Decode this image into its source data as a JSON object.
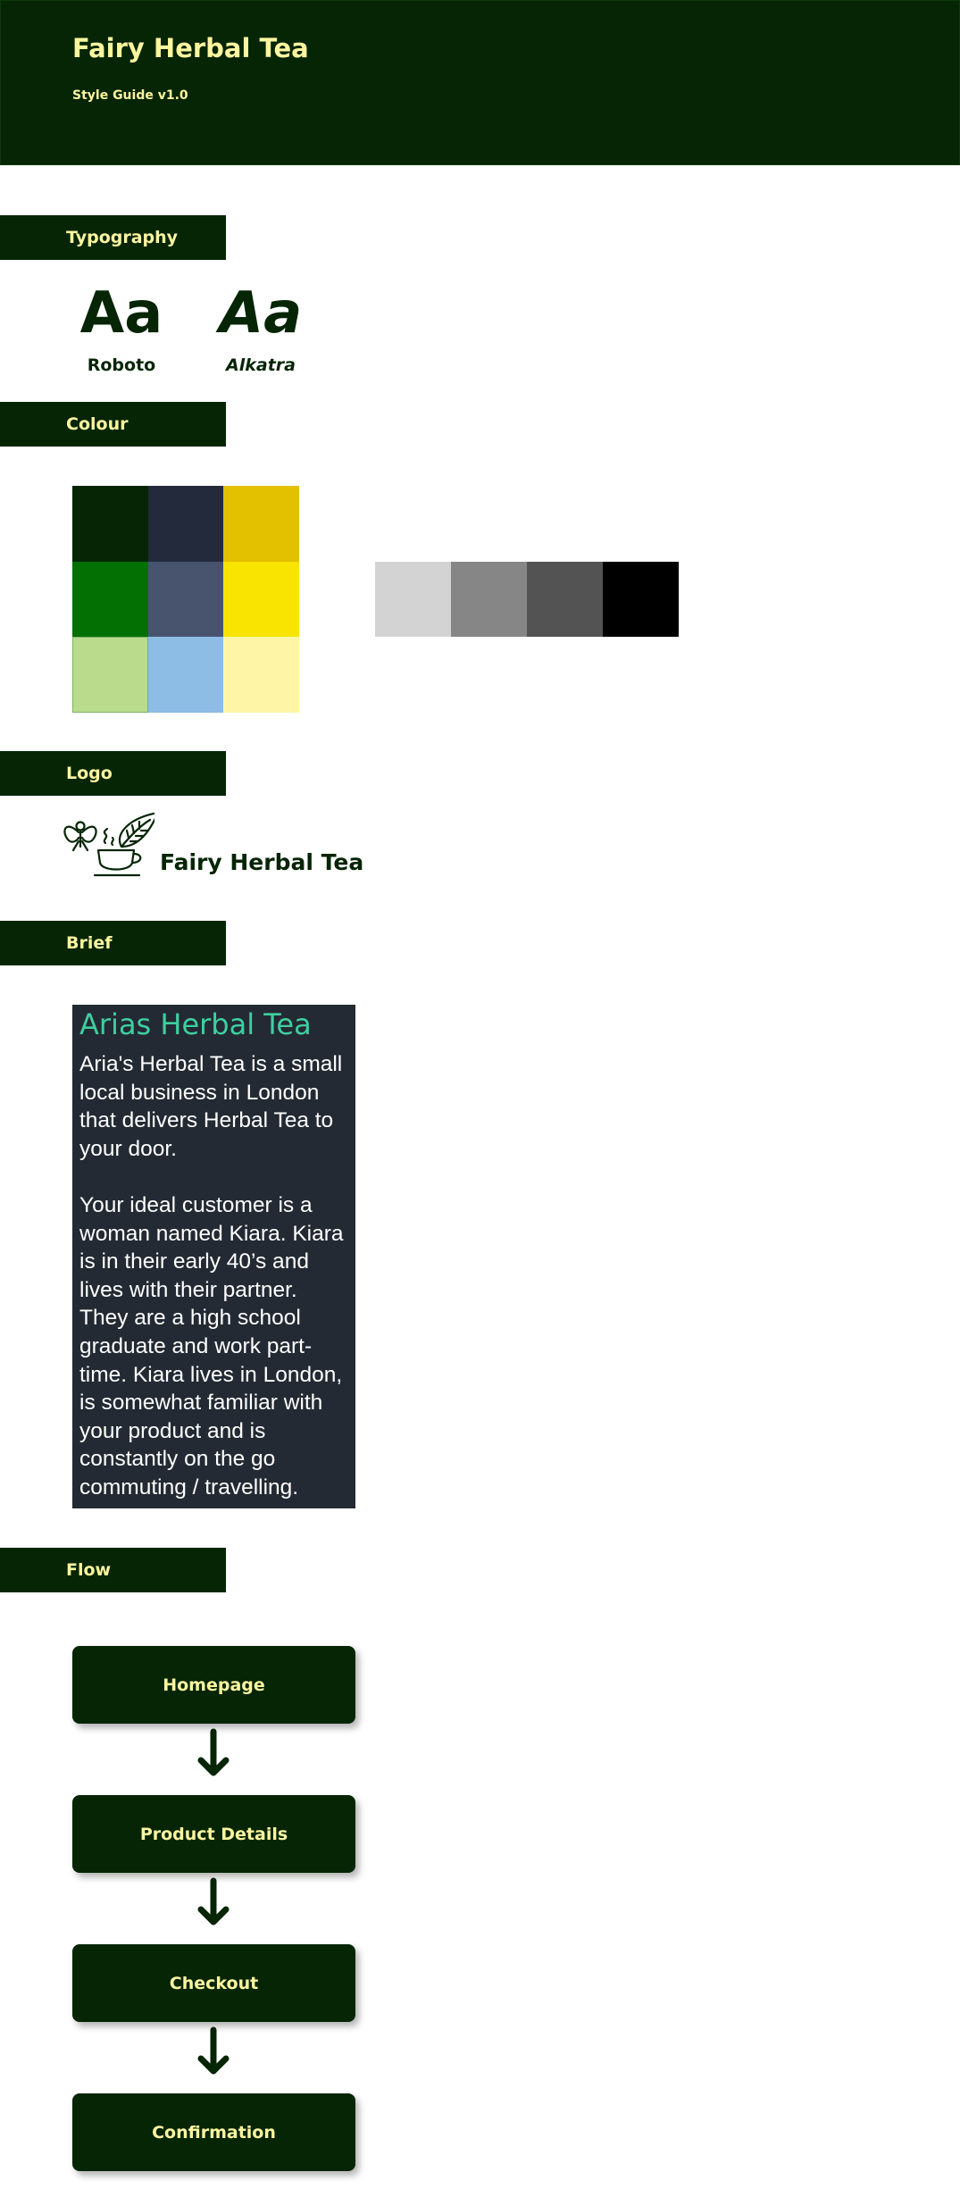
{
  "header": {
    "title": "Fairy Herbal Tea",
    "subtitle": "Style Guide v1.0"
  },
  "sections": {
    "typography": "Typography",
    "colour": "Colour",
    "logo": "Logo",
    "brief": "Brief",
    "flow": "Flow"
  },
  "typography": {
    "fonts": [
      {
        "sample": "Aa",
        "name": "Roboto"
      },
      {
        "sample": "Aa",
        "name": "Alkatra"
      }
    ]
  },
  "colours": {
    "palette_grid": [
      "#052505",
      "#232a3b",
      "#e3c000",
      "#037003",
      "#48546e",
      "#f9e300",
      "#b9db8b",
      "#8dbde4",
      "#fef6a6"
    ],
    "greys": [
      "#d3d3d3",
      "#868686",
      "#535353",
      "#000000"
    ]
  },
  "logo": {
    "text": "Fairy Herbal Tea",
    "icon": "fairy-teacup-leaf-icon"
  },
  "brief": {
    "title": "Arias Herbal Tea",
    "paragraphs": [
      "Aria's Herbal Tea is a small local business in London that delivers Herbal Tea to your door.",
      "Your ideal customer is a woman named Kiara. Kiara is in their early 40’s and lives with their partner. They are a high school graduate and work part-time. Kiara lives in London, is somewhat familiar with your product and is constantly on the go commuting / travelling."
    ]
  },
  "flow": {
    "steps": [
      "Homepage",
      "Product Details",
      "Checkout",
      "Confirmation"
    ]
  }
}
